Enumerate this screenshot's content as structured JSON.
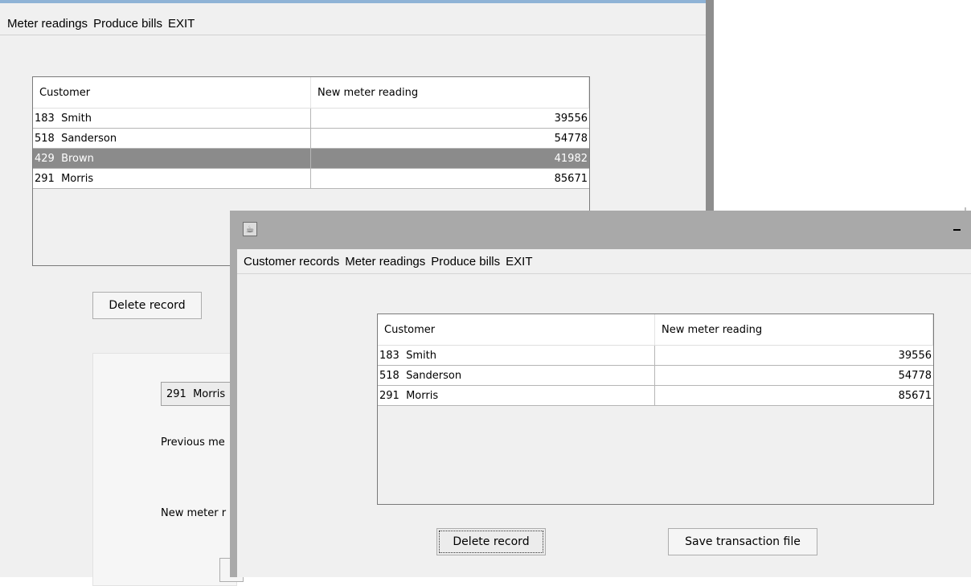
{
  "back_window": {
    "menu": [
      "Meter readings",
      "Produce bills",
      "EXIT"
    ],
    "table": {
      "headers": [
        "Customer",
        "New meter reading"
      ],
      "rows": [
        {
          "customer": "183  Smith",
          "reading": "39556"
        },
        {
          "customer": "518  Sanderson",
          "reading": "54778"
        },
        {
          "customer": "429  Brown",
          "reading": "41982"
        },
        {
          "customer": "291  Morris",
          "reading": "85671"
        }
      ],
      "selected_row": 3
    },
    "delete_button": "Delete record",
    "customer_select": "291  Morris",
    "previous_label": "Previous me",
    "new_label": "New meter r"
  },
  "front_window": {
    "menu": [
      "Customer records",
      "Meter readings",
      "Produce bills",
      "EXIT"
    ],
    "app_icon": "java-cup-icon",
    "table": {
      "headers": [
        "Customer",
        "New meter reading"
      ],
      "rows": [
        {
          "customer": "183  Smith",
          "reading": "39556"
        },
        {
          "customer": "518  Sanderson",
          "reading": "54778"
        },
        {
          "customer": "291  Morris",
          "reading": "85671"
        }
      ]
    },
    "delete_button": "Delete record",
    "save_button": "Save transaction file"
  },
  "colors": {
    "window_bg": "#f0f0f0",
    "title_bar": "#a9a9a9",
    "selected_row": "#8b8b8b"
  }
}
